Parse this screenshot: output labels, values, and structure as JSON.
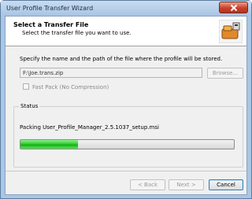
{
  "window": {
    "title": "User Profile Transfer Wizard",
    "close_icon": "close-icon"
  },
  "header": {
    "title": "Select a Transfer File",
    "subtitle": "Select the transfer file you want to use.",
    "logo_icon": "wizard-logo-icon"
  },
  "form": {
    "instructions": "Specify the name and the path of the file where the profile will be stored.",
    "path_value": "F:\\Joe.trans.zip",
    "browse_label": "Browse...",
    "fastpack_label": "Fast Pack (No Compression)",
    "fastpack_checked": false
  },
  "status": {
    "group_label": "Status",
    "message": "Packing User_Profile_Manager_2.5.1037_setup.msi",
    "progress_fraction": 0.27
  },
  "footer": {
    "back_label": "< Back",
    "next_label": "Next >",
    "cancel_label": "Cancel"
  },
  "colors": {
    "progress_green": "#2fcf2f",
    "titlebar": "#a9c6e6",
    "close_red": "#c8412a"
  }
}
